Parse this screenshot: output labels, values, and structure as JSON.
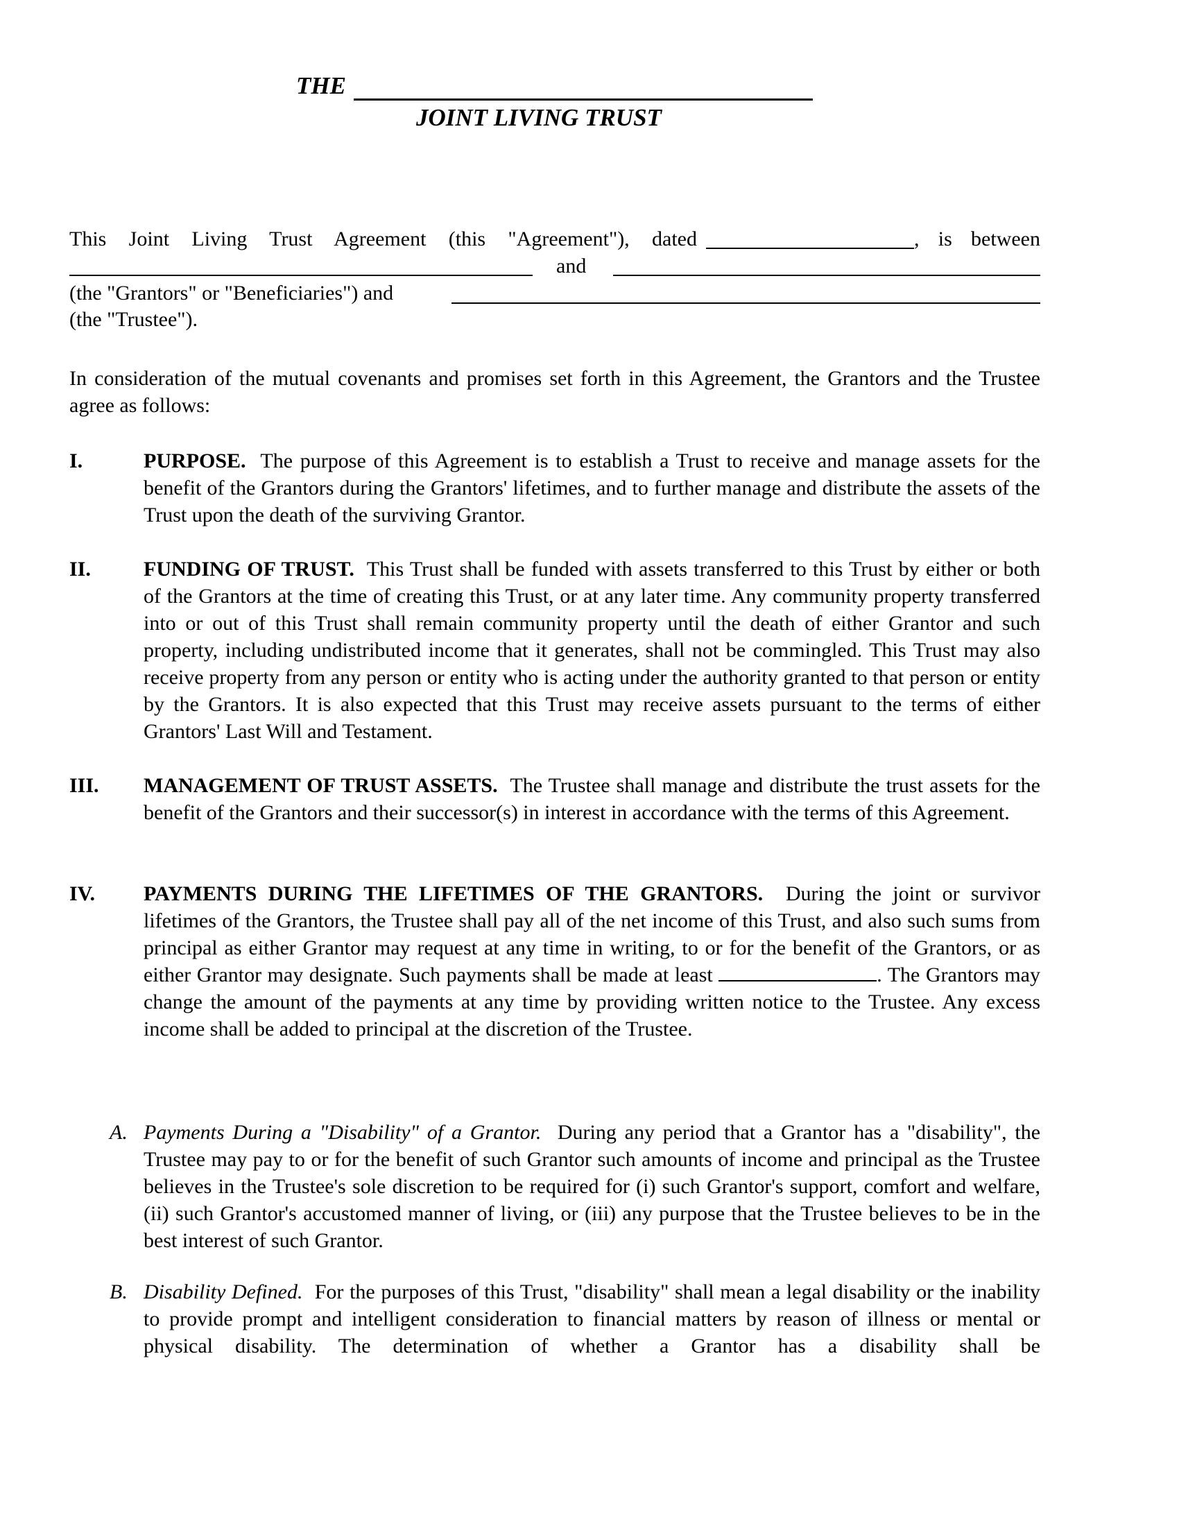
{
  "document": {
    "title_prefix": "THE",
    "title_suffix": "JOINT LIVING TRUST",
    "intro": {
      "line1_a": "This  Joint  Living  Trust  Agreement  (this  \"Agreement\"),  dated",
      "line1_b": ",  is  between",
      "line2_and": "and",
      "line3": "(the \"Grantors\" or \"Beneficiaries\") and",
      "line4": "(the \"Trustee\")."
    },
    "consideration": "In consideration of the mutual covenants and promises set forth in this Agreement, the Grantors and the Trustee agree as follows:",
    "sections": [
      {
        "number": "I.",
        "heading": "PURPOSE.",
        "text": "The purpose of this Agreement is to establish a Trust to receive and manage assets for the benefit of the Grantors during the Grantors' lifetimes, and to further manage and distribute the assets of the Trust upon the death of the surviving Grantor."
      },
      {
        "number": "II.",
        "heading": "FUNDING OF TRUST.",
        "text": "This Trust shall be funded with assets transferred to this Trust by either or both of the Grantors at the time of creating this Trust, or at any later time.  Any community property transferred into or out of this Trust shall remain community property until the death of either Grantor and such property, including undistributed income that it generates, shall not be commingled.  This Trust may also receive property from any person or entity who is acting under the authority granted to that person or entity by the Grantors.  It is also expected that this Trust may receive assets pursuant to the terms of either Grantors' Last Will and Testament."
      },
      {
        "number": "III.",
        "heading": "MANAGEMENT OF TRUST ASSETS.",
        "text": "The Trustee shall manage and distribute the trust assets for the benefit of the Grantors and their successor(s) in interest in accordance with the terms of this Agreement."
      },
      {
        "number": "IV.",
        "heading": "PAYMENTS DURING THE LIFETIMES OF THE GRANTORS.",
        "text_before_blank": "During the joint or survivor lifetimes of the Grantors, the Trustee shall pay all of the net income of this Trust, and also such sums from principal as either Grantor may request at any time in writing, to or for the benefit of the Grantors, or as either Grantor may designate.  Such payments shall be made at least",
        "text_after_blank": ".  The Grantors may change the amount of the payments at any time by providing written notice to the Trustee.  Any excess income shall be added to principal at the discretion of the Trustee."
      }
    ],
    "subsections": [
      {
        "letter": "A.",
        "heading": "Payments During a \"Disability\" of a Grantor.",
        "text": "During any period that a Grantor has a \"disability\", the Trustee may pay to or for the benefit of such Grantor such amounts of income and principal as the Trustee believes in the Trustee's sole discretion to be required for (i) such Grantor's support, comfort and welfare, (ii) such Grantor's accustomed manner of living, or (iii) any purpose that the Trustee believes to be in the best interest of such Grantor."
      },
      {
        "letter": "B.",
        "heading": "Disability Defined.",
        "text": "For the purposes of this Trust, \"disability\" shall mean a legal disability or the inability to provide prompt and intelligent consideration to financial matters by reason of illness or mental or physical disability.  The determination of whether a Grantor has a disability shall be"
      }
    ]
  }
}
